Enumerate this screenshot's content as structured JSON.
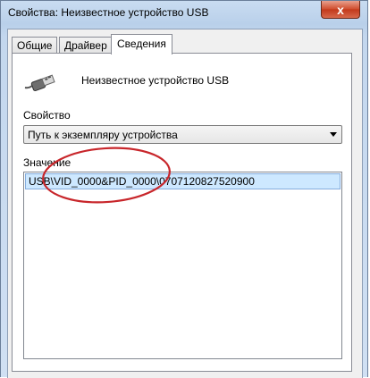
{
  "window": {
    "title": "Свойства: Неизвестное устройство USB",
    "close_glyph": "x"
  },
  "tabs": [
    {
      "label": "Общие",
      "active": false
    },
    {
      "label": "Драйвер",
      "active": false
    },
    {
      "label": "Сведения",
      "active": true
    }
  ],
  "device": {
    "icon": "usb-plug-icon",
    "name": "Неизвестное устройство USB"
  },
  "property": {
    "label": "Свойство",
    "selected": "Путь к экземпляру устройства"
  },
  "value": {
    "label": "Значение",
    "items": [
      "USB\\VID_0000&PID_0000\\0707120827520900"
    ]
  },
  "annotation": {
    "color": "#c8262b"
  }
}
